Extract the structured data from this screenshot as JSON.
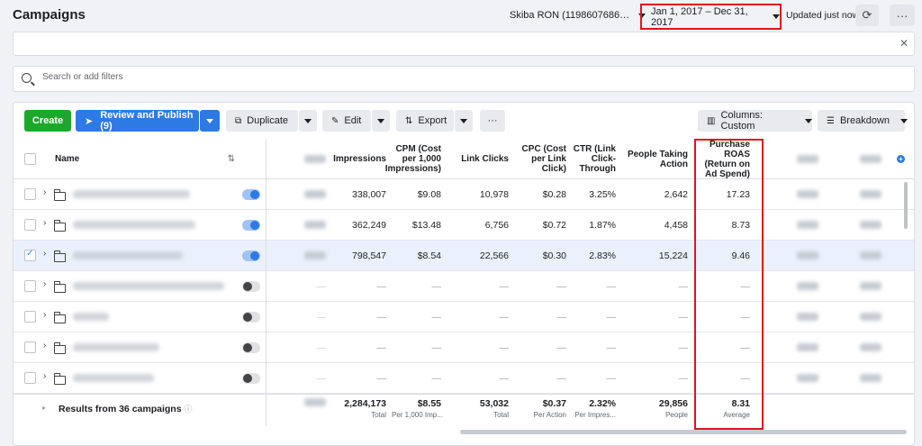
{
  "header": {
    "title": "Campaigns",
    "account": "Skiba RON (1198607686…",
    "date_range": "Jan 1, 2017 – Dec 31, 2017",
    "updated": "Updated just now"
  },
  "search": {
    "placeholder": "Search or add filters"
  },
  "toolbar": {
    "create": "Create",
    "review_publish": "Review and Publish (9)",
    "duplicate": "Duplicate",
    "edit": "Edit",
    "export": "Export",
    "more": "···",
    "columns": "Columns: Custom",
    "breakdown": "Breakdown"
  },
  "table": {
    "columns": {
      "name": "Name",
      "impressions": "Impressions",
      "cpm": "CPM (Cost per 1,000 Impressions)",
      "link_clicks": "Link Clicks",
      "cpc": "CPC (Cost per Link Click)",
      "ctr": "CTR (Link Click-Through",
      "people": "People Taking Action",
      "roas": "Purchase ROAS (Return on Ad Spend)"
    },
    "rows": [
      {
        "selected": false,
        "delivery_on": true,
        "impressions": "338,007",
        "cpm": "$9.08",
        "link_clicks": "10,978",
        "cpc": "$0.28",
        "ctr": "3.25%",
        "people": "2,642",
        "roas": "17.23"
      },
      {
        "selected": false,
        "delivery_on": true,
        "impressions": "362,249",
        "cpm": "$13.48",
        "link_clicks": "6,756",
        "cpc": "$0.72",
        "ctr": "1.87%",
        "people": "4,458",
        "roas": "8.73"
      },
      {
        "selected": true,
        "delivery_on": true,
        "impressions": "798,547",
        "cpm": "$8.54",
        "link_clicks": "22,566",
        "cpc": "$0.30",
        "ctr": "2.83%",
        "people": "15,224",
        "roas": "9.46"
      },
      {
        "selected": false,
        "delivery_on": false,
        "impressions": "—",
        "cpm": "—",
        "link_clicks": "—",
        "cpc": "—",
        "ctr": "—",
        "people": "—",
        "roas": "—"
      },
      {
        "selected": false,
        "delivery_on": false,
        "impressions": "—",
        "cpm": "—",
        "link_clicks": "—",
        "cpc": "—",
        "ctr": "—",
        "people": "—",
        "roas": "—"
      },
      {
        "selected": false,
        "delivery_on": false,
        "impressions": "—",
        "cpm": "—",
        "link_clicks": "—",
        "cpc": "—",
        "ctr": "—",
        "people": "—",
        "roas": "—"
      },
      {
        "selected": false,
        "delivery_on": false,
        "impressions": "—",
        "cpm": "—",
        "link_clicks": "—",
        "cpc": "—",
        "ctr": "—",
        "people": "—",
        "roas": "—"
      }
    ],
    "summary": {
      "label": "Results from 36 campaigns",
      "impressions": {
        "value": "2,284,173",
        "sub": "Total"
      },
      "cpm": {
        "value": "$8.55",
        "sub": "Per 1,000 Imp..."
      },
      "link_clicks": {
        "value": "53,032",
        "sub": "Total"
      },
      "cpc": {
        "value": "$0.37",
        "sub": "Per Action"
      },
      "ctr": {
        "value": "2.32%",
        "sub": "Per Impres..."
      },
      "people": {
        "value": "29,856",
        "sub": "People"
      },
      "roas": {
        "value": "8.31",
        "sub": "Average"
      }
    }
  },
  "colors": {
    "create_green": "#1da82c",
    "primary_blue": "#2d7ae5",
    "highlight_red": "#e0141c"
  }
}
